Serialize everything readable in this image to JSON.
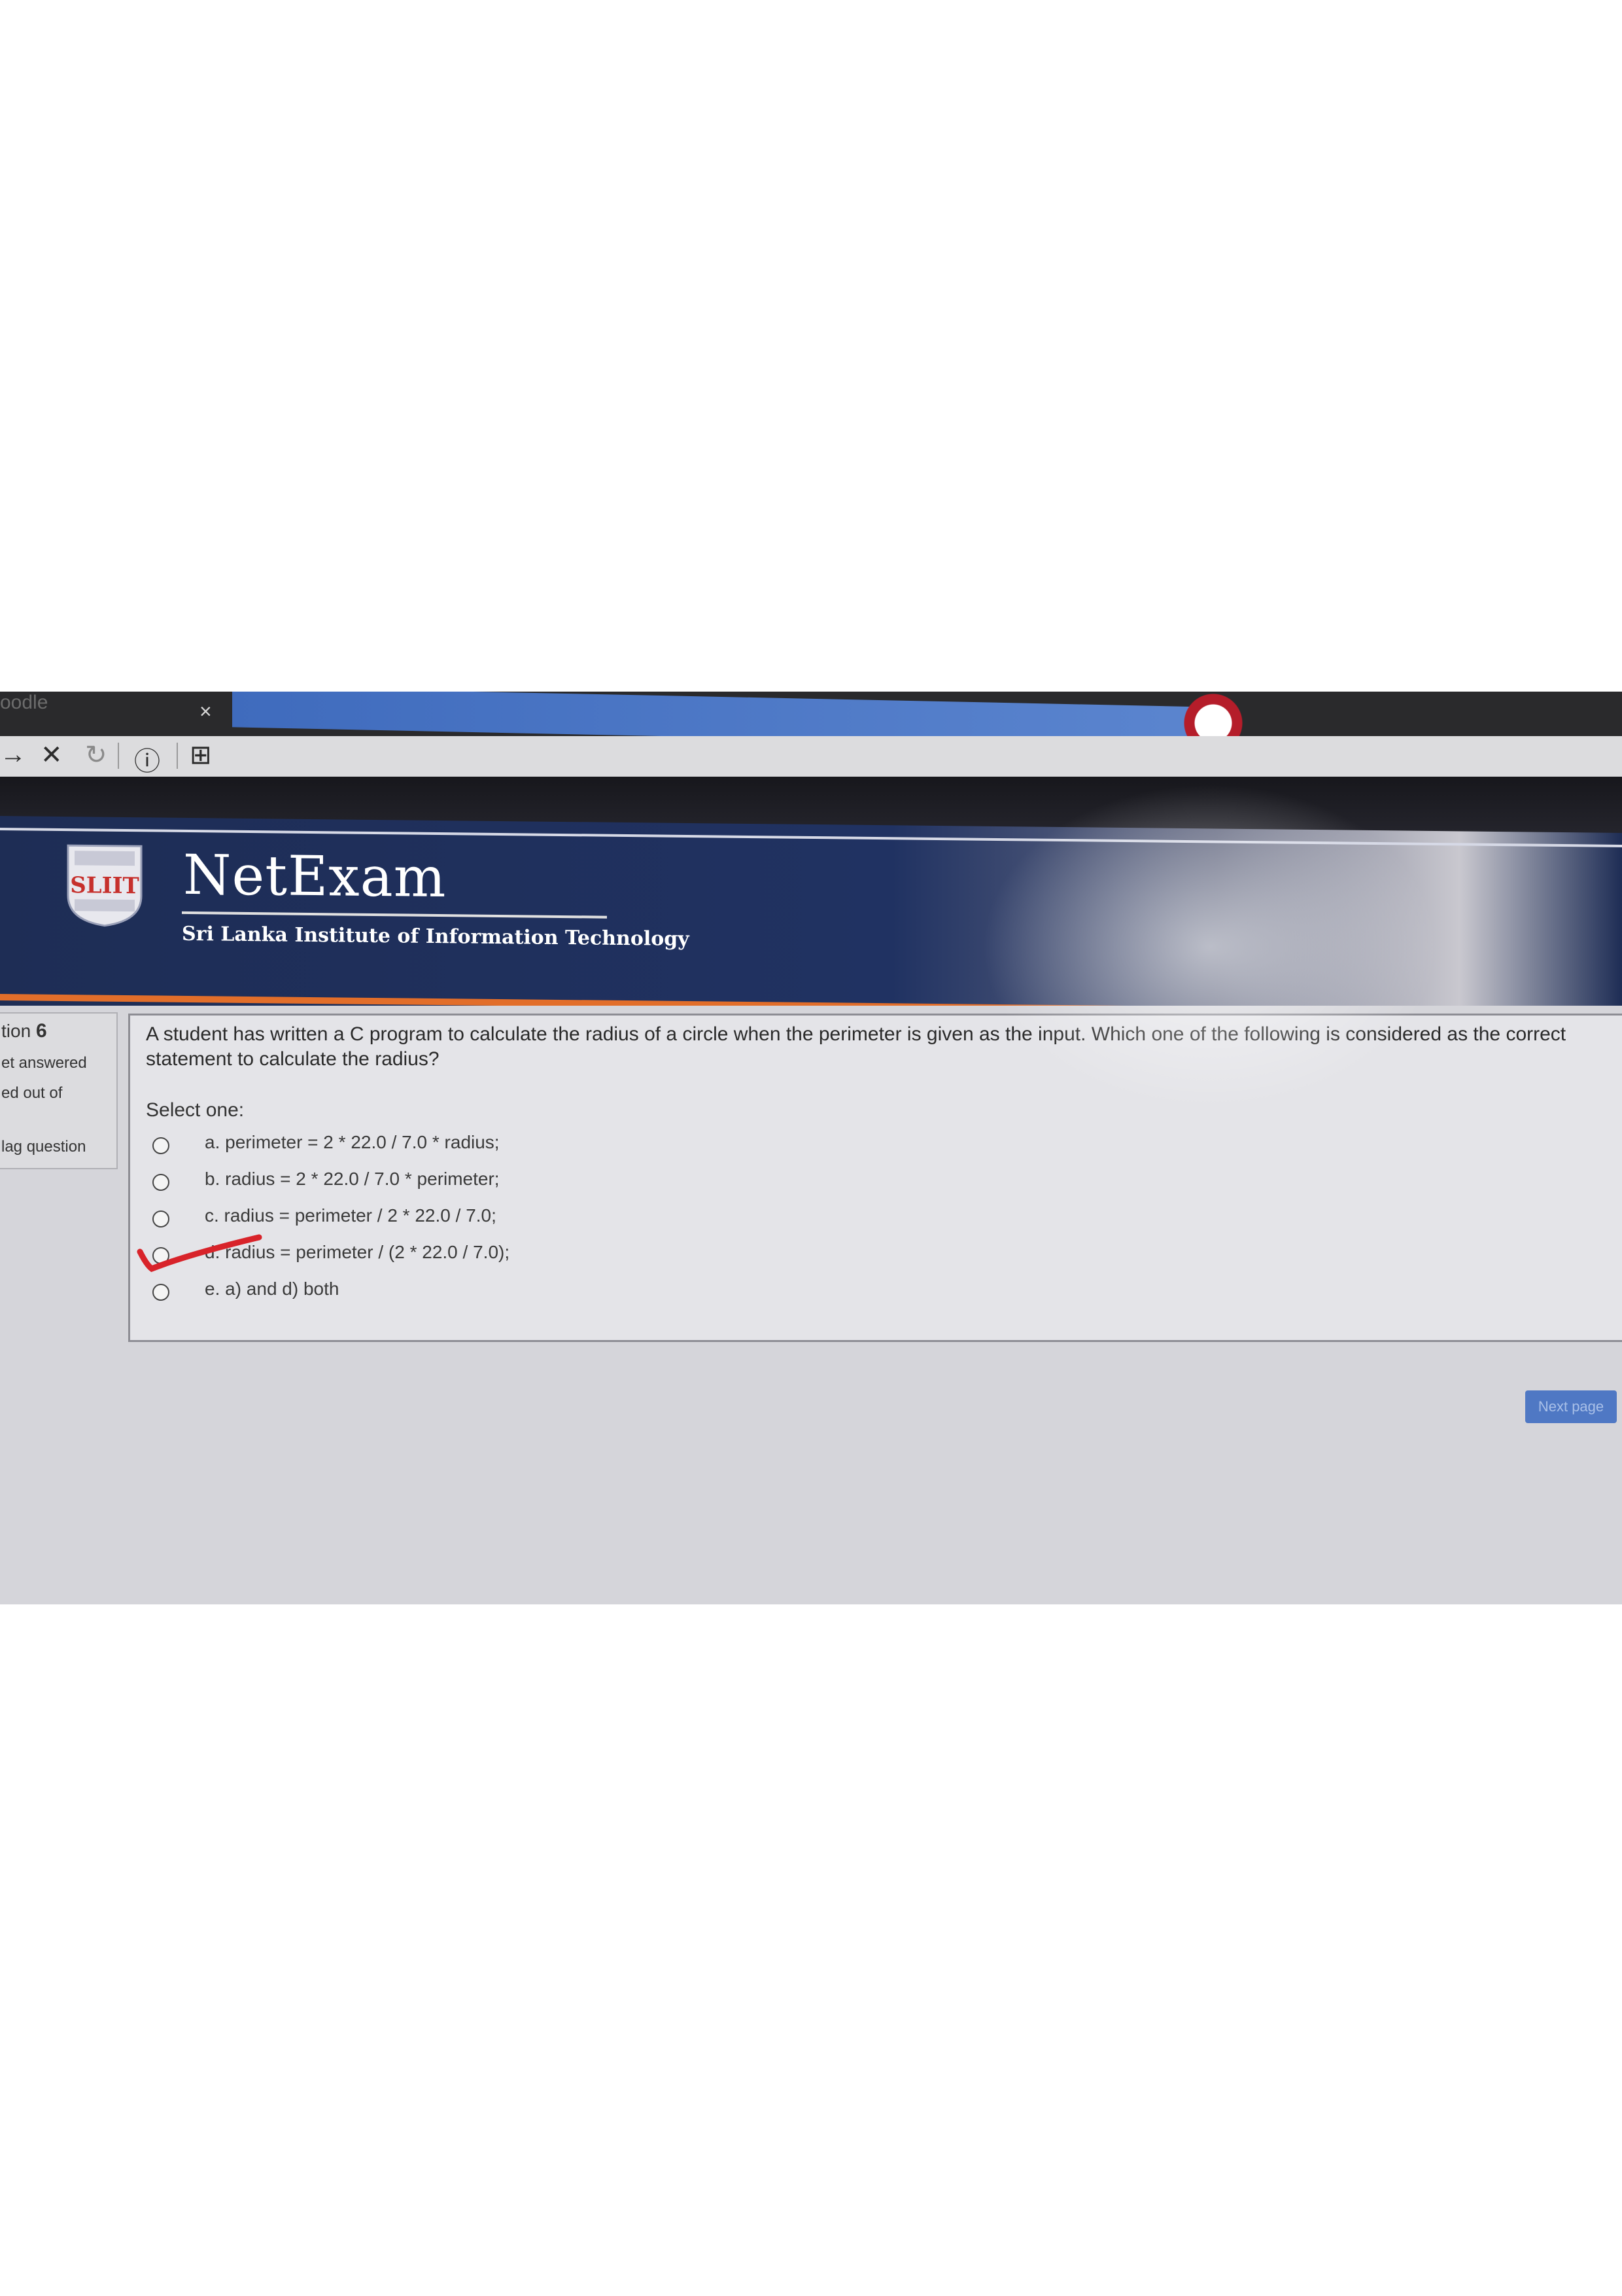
{
  "browser": {
    "tab_title": "oodle",
    "tab_close": "×",
    "nav_back": "→",
    "nav_stop": "✕",
    "nav_reload": "↻",
    "info_icon": "ⓘ",
    "page_icon": "⊞"
  },
  "header": {
    "logo_text": "SLIIT",
    "site_title": "NetExam",
    "subtitle": "Sri Lanka Institute of Information Technology"
  },
  "question_info": {
    "label": "tion",
    "number": "6",
    "status": "et answered",
    "mark": "ed out of",
    "flag": "lag question"
  },
  "question": {
    "text": "A student has written a C program to calculate the radius of a circle when the perimeter is given as the input. Which one of the following is considered as the correct statement to calculate the radius?",
    "select_label": "Select one:",
    "options": [
      {
        "label": "a. perimeter = 2 * 22.0 / 7.0 * radius;"
      },
      {
        "label": "b. radius = 2 * 22.0 / 7.0 * perimeter;"
      },
      {
        "label": "c. radius = perimeter / 2 * 22.0 / 7.0;"
      },
      {
        "label": "d. radius = perimeter / (2 * 22.0 / 7.0);"
      },
      {
        "label": "e. a) and d) both"
      }
    ]
  },
  "next_button": "Next page",
  "colors": {
    "banner": "#1e2d55",
    "accent_orange": "#e26e2a",
    "button_blue": "#4f78c4",
    "check_red": "#d8232a"
  }
}
